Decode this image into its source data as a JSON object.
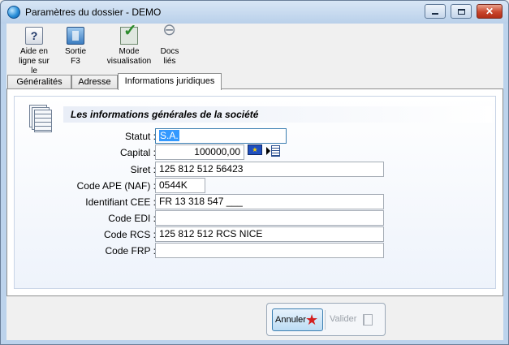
{
  "window": {
    "title": "Paramètres du dossier - DEMO"
  },
  "toolbar": {
    "help": {
      "line1": "Aide en",
      "line2": "ligne sur le"
    },
    "exit": {
      "line1": "Sortie",
      "line2": "F3"
    },
    "view": {
      "line1": "Mode",
      "line2": "visualisation"
    },
    "docs": {
      "line1": "Docs",
      "line2": "liés"
    }
  },
  "tabs": [
    {
      "label": "Généralités"
    },
    {
      "label": "Adresse"
    },
    {
      "label": "Informations juridiques",
      "active": true
    }
  ],
  "section": {
    "title": "Les informations générales de la société"
  },
  "form": {
    "statut": {
      "label": "Statut :",
      "value": "S.A."
    },
    "capital": {
      "label": "Capital :",
      "value": "100000,00"
    },
    "siret": {
      "label": "Siret :",
      "value": "125 812 512 56423"
    },
    "ape": {
      "label": "Code APE (NAF) :",
      "value": "0544K"
    },
    "cee": {
      "label": "Identifiant CEE :",
      "value": "FR 13 318 547 ___"
    },
    "edi": {
      "label": "Code EDI :",
      "value": ""
    },
    "rcs": {
      "label": "Code RCS :",
      "value": "125 812 512  RCS NICE"
    },
    "frp": {
      "label": "Code FRP :",
      "value": ""
    }
  },
  "actions": {
    "cancel": "Annuler",
    "validate": "Valider"
  },
  "colors": {
    "accent": "#3399ff",
    "titlebar": "#b9d0ea",
    "cancel_icon": "#d31f1f"
  }
}
